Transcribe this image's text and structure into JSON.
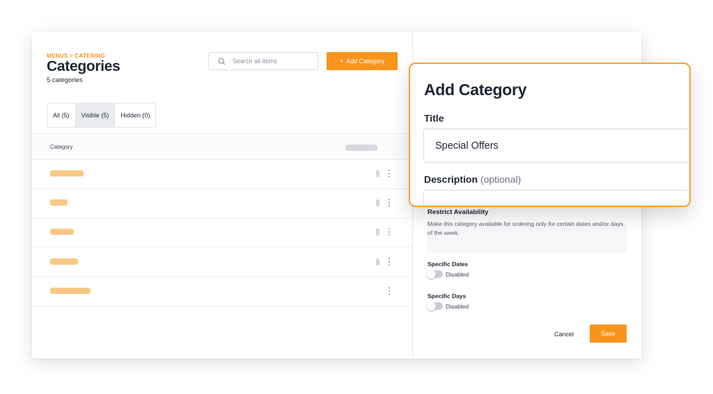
{
  "breadcrumb": {
    "parent": "MENUS",
    "separator": ">",
    "current": "CATERING"
  },
  "page": {
    "title": "Categories",
    "subtitle": "5 categories"
  },
  "search": {
    "placeholder": "Search all items"
  },
  "add_button": {
    "icon": "+",
    "label": "Add Category"
  },
  "tabs": [
    {
      "label": "All (5)",
      "active": false
    },
    {
      "label": "Visible (5)",
      "active": true
    },
    {
      "label": "Hidden (0)",
      "active": false
    }
  ],
  "table": {
    "column_header": "Category",
    "rows": [
      {
        "has_toggle": true
      },
      {
        "has_toggle": true
      },
      {
        "has_toggle": true
      },
      {
        "has_toggle": true
      },
      {
        "has_toggle": false
      }
    ],
    "kebab_glyph": "⋮"
  },
  "side_panel": {
    "restrict_title": "Restrict Availability",
    "restrict_description": "Make this category available for ordering only for certain dates and/or days of the week.",
    "specific_dates": {
      "label": "Specific Dates",
      "state": "Disabled"
    },
    "specific_days": {
      "label": "Specific Days",
      "state": "Disabled"
    },
    "cancel_label": "Cancel",
    "save_label": "Save"
  },
  "popup": {
    "heading": "Add Category",
    "title_label": "Title",
    "title_value": "Special Offers",
    "description_label": "Description",
    "description_optional": "(optional)"
  },
  "colors": {
    "accent": "#f7941d",
    "placeholder_bar": "#f9c885",
    "popup_border": "#f7a035"
  }
}
